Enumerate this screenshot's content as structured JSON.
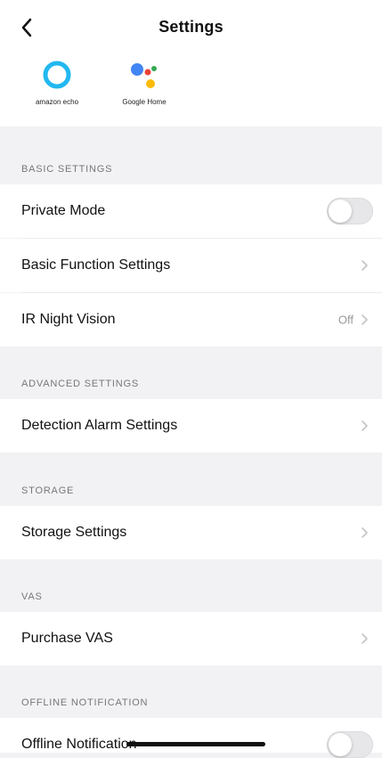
{
  "header": {
    "title": "Settings"
  },
  "assistants": [
    {
      "name": "amazon echo",
      "icon": "alexa-ring-icon",
      "color": "#22b8f0"
    },
    {
      "name": "Google Home",
      "icon": "google-assistant-dots-icon",
      "colors": [
        "#4285F4",
        "#EA4335",
        "#FBBC05",
        "#34A853"
      ]
    }
  ],
  "sections": {
    "basic": {
      "title": "BASIC SETTINGS",
      "private_mode": {
        "label": "Private Mode",
        "enabled": false
      },
      "basic_function": {
        "label": "Basic Function Settings"
      },
      "ir_night_vision": {
        "label": "IR Night Vision",
        "value": "Off"
      }
    },
    "advanced": {
      "title": "ADVANCED SETTINGS",
      "detection_alarm": {
        "label": "Detection Alarm Settings"
      }
    },
    "storage": {
      "title": "STORAGE",
      "storage_settings": {
        "label": "Storage Settings"
      }
    },
    "vas": {
      "title": "VAS",
      "purchase_vas": {
        "label": "Purchase VAS"
      }
    },
    "offline": {
      "title": "OFFLINE NOTIFICATION",
      "offline_notification": {
        "label": "Offline Notification",
        "enabled": false
      }
    }
  }
}
